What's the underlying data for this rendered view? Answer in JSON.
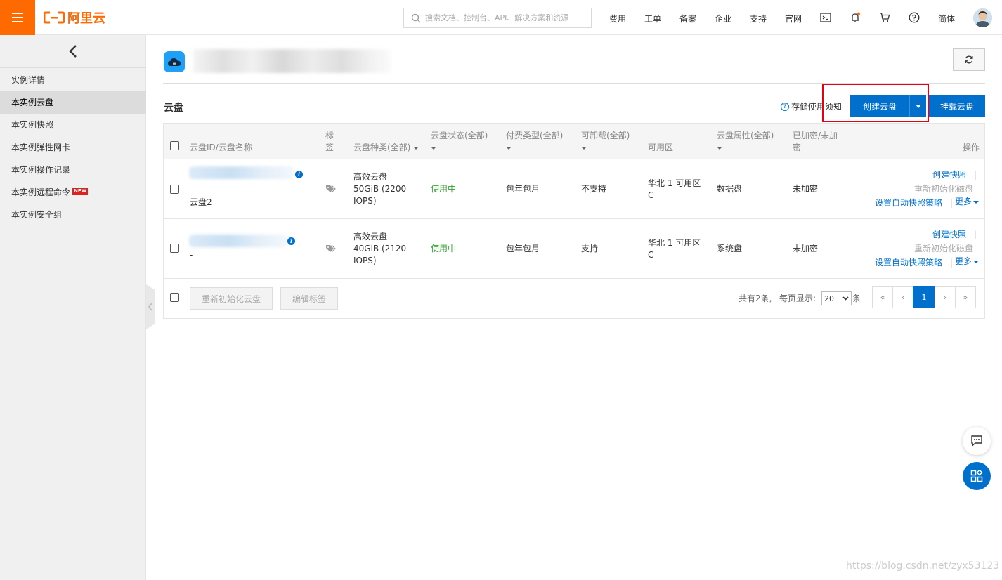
{
  "topbar": {
    "logo_text": "阿里云",
    "search_placeholder": "搜索文档、控制台、API、解决方案和资源",
    "nav": [
      "费用",
      "工单",
      "备案",
      "企业",
      "支持",
      "官网"
    ],
    "lang": "简体",
    "accent": "#ff6a00"
  },
  "sidebar": {
    "items": [
      {
        "label": "实例详情"
      },
      {
        "label": "本实例云盘"
      },
      {
        "label": "本实例快照"
      },
      {
        "label": "本实例弹性网卡"
      },
      {
        "label": "本实例操作记录"
      },
      {
        "label": "本实例远程命令",
        "badge": "NEW"
      },
      {
        "label": "本实例安全组"
      }
    ]
  },
  "main": {
    "section_title": "云盘",
    "help_link": "存储使用须知",
    "create_button": "创建云盘",
    "mount_button": "挂载云盘",
    "primary_color": "#0070cc"
  },
  "table": {
    "headers": {
      "id": "云盘ID/云盘名称",
      "tag": "标签",
      "type": "云盘种类(全部)",
      "status": "云盘状态(全部)",
      "billing": "付费类型(全部)",
      "detach": "可卸载(全部)",
      "zone": "可用区",
      "attr": "云盘属性(全部)",
      "encrypt": "已加密/未加密",
      "ops": "操作"
    },
    "rows": [
      {
        "name": "云盘2",
        "type": "高效云盘",
        "spec": "50GiB (2200",
        "iops": "IOPS)",
        "status": "使用中",
        "billing": "包年包月",
        "detach": "不支持",
        "zone1": "华北 1 可用区",
        "zone2": "C",
        "attr": "数据盘",
        "encrypt": "未加密",
        "op1": "创建快照",
        "op2": "重新初始化磁盘",
        "op3": "设置自动快照策略",
        "op4": "更多"
      },
      {
        "name": "-",
        "type": "高效云盘",
        "spec": "40GiB (2120",
        "iops": "IOPS)",
        "status": "使用中",
        "billing": "包年包月",
        "detach": "支持",
        "zone1": "华北 1 可用区",
        "zone2": "C",
        "attr": "系统盘",
        "encrypt": "未加密",
        "op1": "创建快照",
        "op2": "重新初始化磁盘",
        "op3": "设置自动快照策略",
        "op4": "更多"
      }
    ],
    "footer": {
      "reinit_button": "重新初始化云盘",
      "edit_tags_button": "编辑标签",
      "total": "共有2条,",
      "per_page_label": "每页显示:",
      "page_size": "20",
      "unit": "条",
      "first": "«",
      "prev": "‹",
      "current_page": "1",
      "next": "›",
      "last": "»"
    }
  },
  "watermark": "https://blog.csdn.net/zyx53123"
}
